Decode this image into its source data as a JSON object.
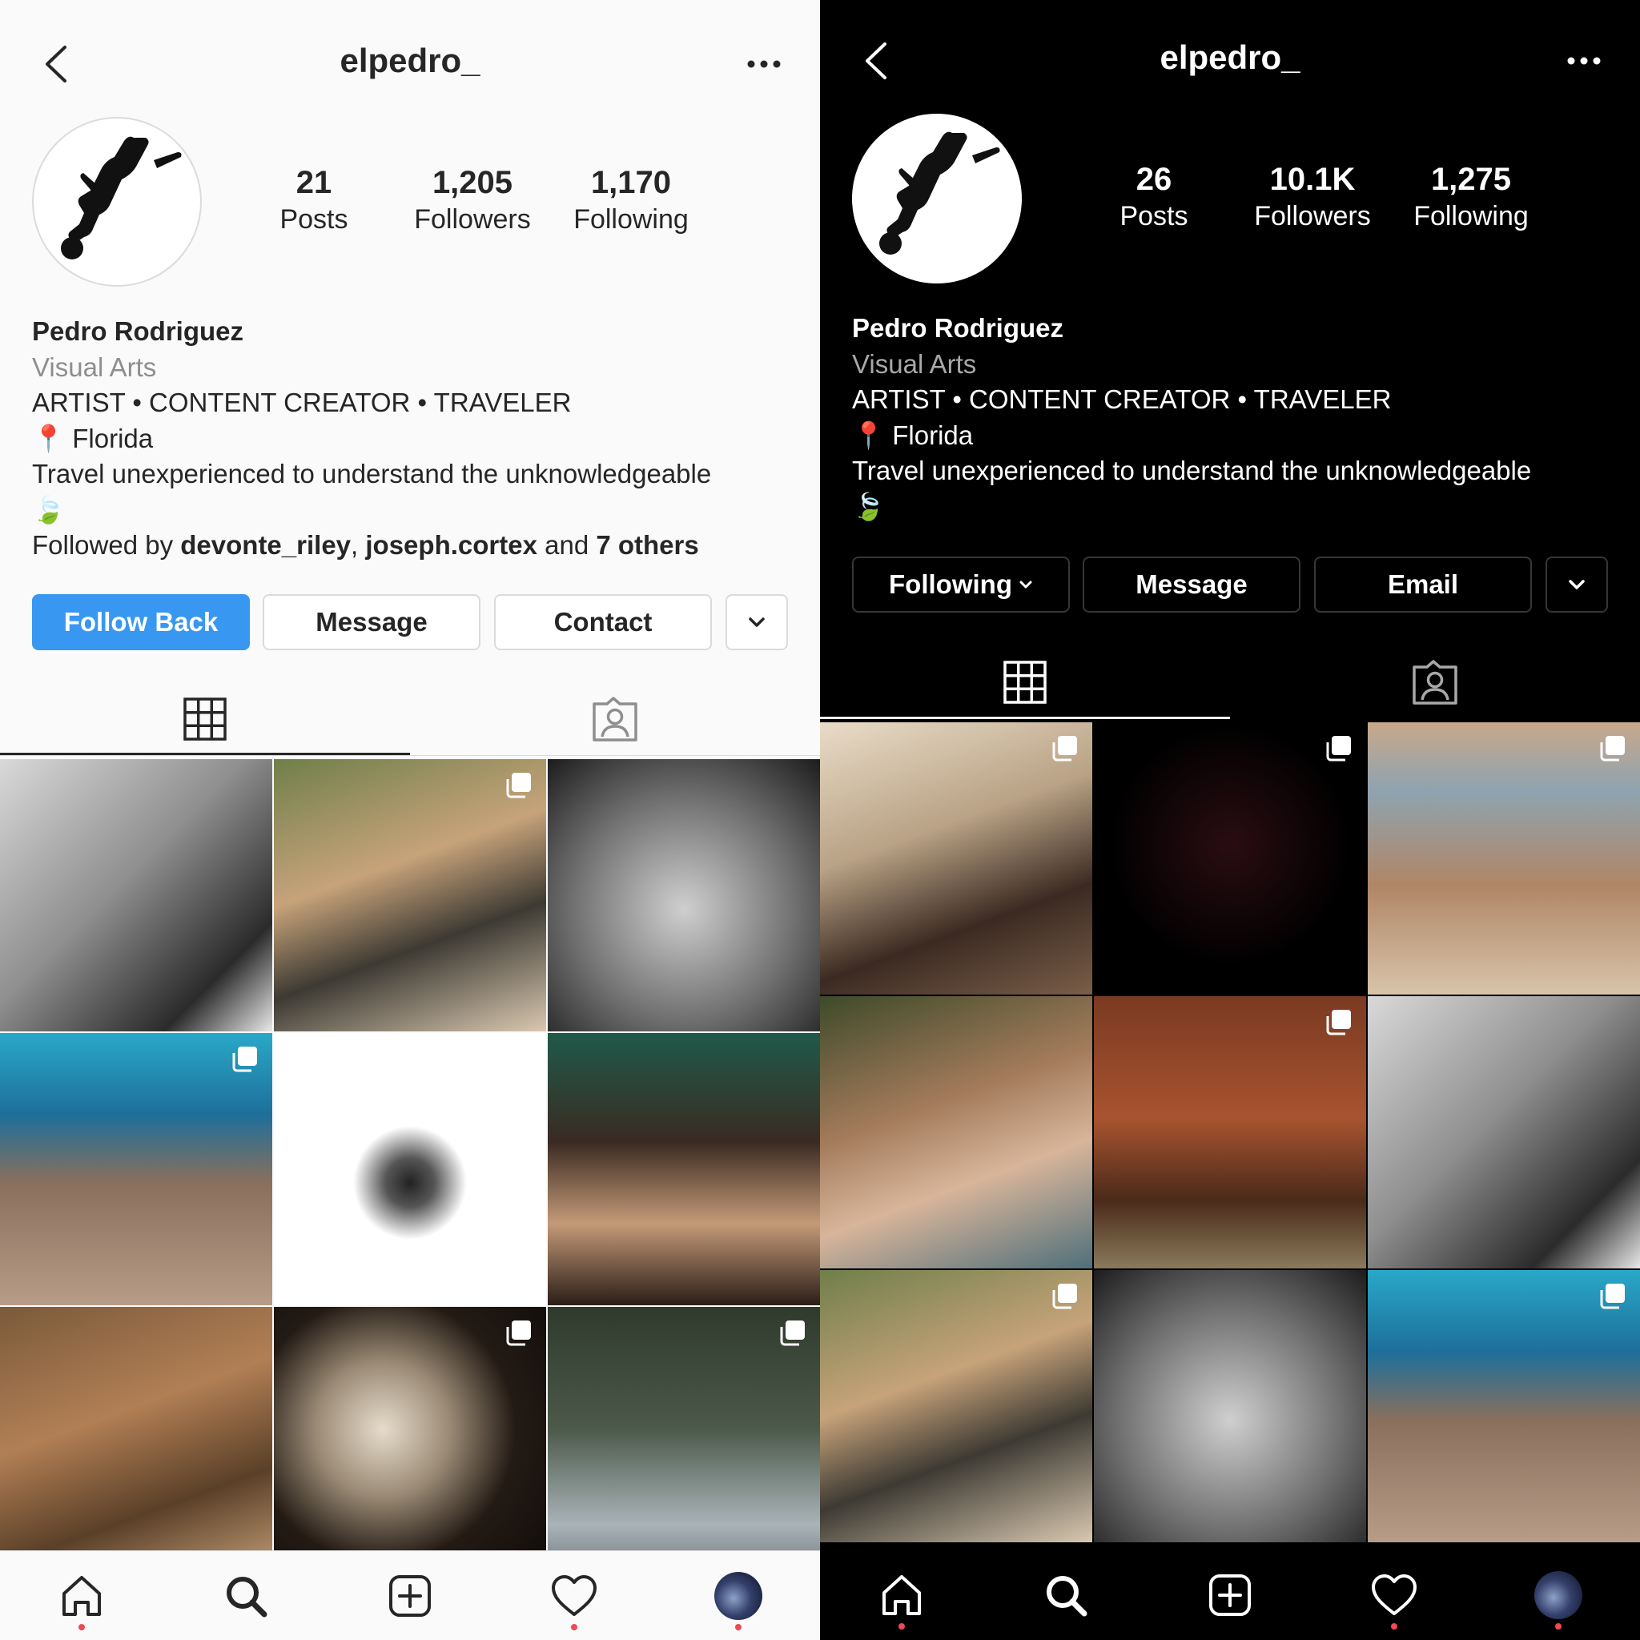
{
  "colors": {
    "accent_blue": "#3897f0",
    "notification_red": "#ed4956",
    "light_bg": "#fafafa",
    "dark_bg": "#000000"
  },
  "light": {
    "username": "elpedro_",
    "stats": [
      {
        "value": "21",
        "label": "Posts"
      },
      {
        "value": "1,205",
        "label": "Followers"
      },
      {
        "value": "1,170",
        "label": "Following"
      }
    ],
    "bio": {
      "name": "Pedro Rodriguez",
      "category": "Visual Arts",
      "tagline": "ARTIST • CONTENT CREATOR • TRAVELER",
      "location": "📍 Florida",
      "quote": "Travel unexperienced to understand the unknowledgeable",
      "emoji": "🍃",
      "followed_prefix": "Followed by ",
      "followed_user1": "devonte_riley",
      "followed_sep": ", ",
      "followed_user2": "joseph.cortex",
      "followed_and": " and ",
      "followed_others": "7 others"
    },
    "buttons": {
      "primary": "Follow Back",
      "message": "Message",
      "contact": "Contact"
    },
    "posts": [
      {
        "bg": "linear-gradient(135deg,#d9d9d9,#8f8f8f 45%,#2b2b2b 80%,#e8e8e8)",
        "multi": false
      },
      {
        "bg": "linear-gradient(160deg,#6f7f4a,#c7a37a 40%,#3d3a33 65%,#d9c8b0)",
        "multi": true
      },
      {
        "bg": "radial-gradient(circle at 50% 55%,#cfcfcf,#707070 55%,#1c1c1c)",
        "multi": false
      },
      {
        "bg": "linear-gradient(180deg,#29a8c8 0%,#1e6f9a 30%,#8a6f5c 55%,#b79c88 100%)",
        "multi": true
      },
      {
        "bg": "radial-gradient(circle at 50% 55%,#222 0%,#555 12%,#fff 28%)",
        "multi": false
      },
      {
        "bg": "linear-gradient(180deg,#1f5a4a,#3a2a22 40%,#c49a78 70%,#2b1e18)",
        "multi": false
      },
      {
        "bg": "linear-gradient(160deg,#7a5a3a,#b27f55 40%,#5a4028 70%,#c9a27a)",
        "multi": false
      },
      {
        "bg": "radial-gradient(circle at 40% 45%,#e6dccb 0%,#9b8b76 30%,#231a14 60%,#0f0b08)",
        "multi": true
      },
      {
        "bg": "linear-gradient(180deg,#2f3a2c,#4c5a4a 45%,#a9b3b8 80%,#6b7378)",
        "multi": true
      }
    ],
    "nav_icons": [
      "home-icon",
      "search-icon",
      "add-post-icon",
      "heart-icon"
    ]
  },
  "dark": {
    "username": "elpedro_",
    "stats": [
      {
        "value": "26",
        "label": "Posts"
      },
      {
        "value": "10.1K",
        "label": "Followers"
      },
      {
        "value": "1,275",
        "label": "Following"
      }
    ],
    "bio": {
      "name": "Pedro Rodriguez",
      "category": "Visual Arts",
      "tagline": "ARTIST • CONTENT CREATOR • TRAVELER",
      "location": "📍 Florida",
      "quote": "Travel unexperienced to understand the unknowledgeable",
      "emoji": "🍃"
    },
    "buttons": {
      "following": "Following",
      "message": "Message",
      "email": "Email"
    },
    "posts": [
      {
        "bg": "linear-gradient(160deg,#e9dcc8,#b9a285 40%,#3b2a22 70%,#7a5e48)",
        "multi": true
      },
      {
        "bg": "radial-gradient(circle at 50% 45%,#2a0d12 0%,#000 60%)",
        "multi": true
      },
      {
        "bg": "linear-gradient(180deg,#c8a88a 0%,#8fa3b0 25%,#b08666 60%,#d8c4aa)",
        "multi": true
      },
      {
        "bg": "linear-gradient(160deg,#3e4a2a,#a37b5b 40%,#d8b59a 65%,#4f6f7a)",
        "multi": false
      },
      {
        "bg": "linear-gradient(180deg,#7a3a22,#a8532f 45%,#4a2a1a 75%,#8a7a5a)",
        "multi": true
      },
      {
        "bg": "linear-gradient(135deg,#d9d9d9,#8f8f8f 45%,#2b2b2b 80%,#e8e8e8)",
        "multi": false
      },
      {
        "bg": "linear-gradient(160deg,#6f7f4a,#c7a37a 40%,#3d3a33 65%,#d9c8b0)",
        "multi": true
      },
      {
        "bg": "radial-gradient(circle at 50% 55%,#cfcfcf,#707070 55%,#1c1c1c)",
        "multi": false
      },
      {
        "bg": "linear-gradient(180deg,#29a8c8 0%,#1e6f9a 30%,#8a6f5c 55%,#b79c88 100%)",
        "multi": true
      }
    ],
    "nav_icons": [
      "home-icon",
      "search-icon",
      "add-post-icon",
      "heart-icon"
    ]
  }
}
